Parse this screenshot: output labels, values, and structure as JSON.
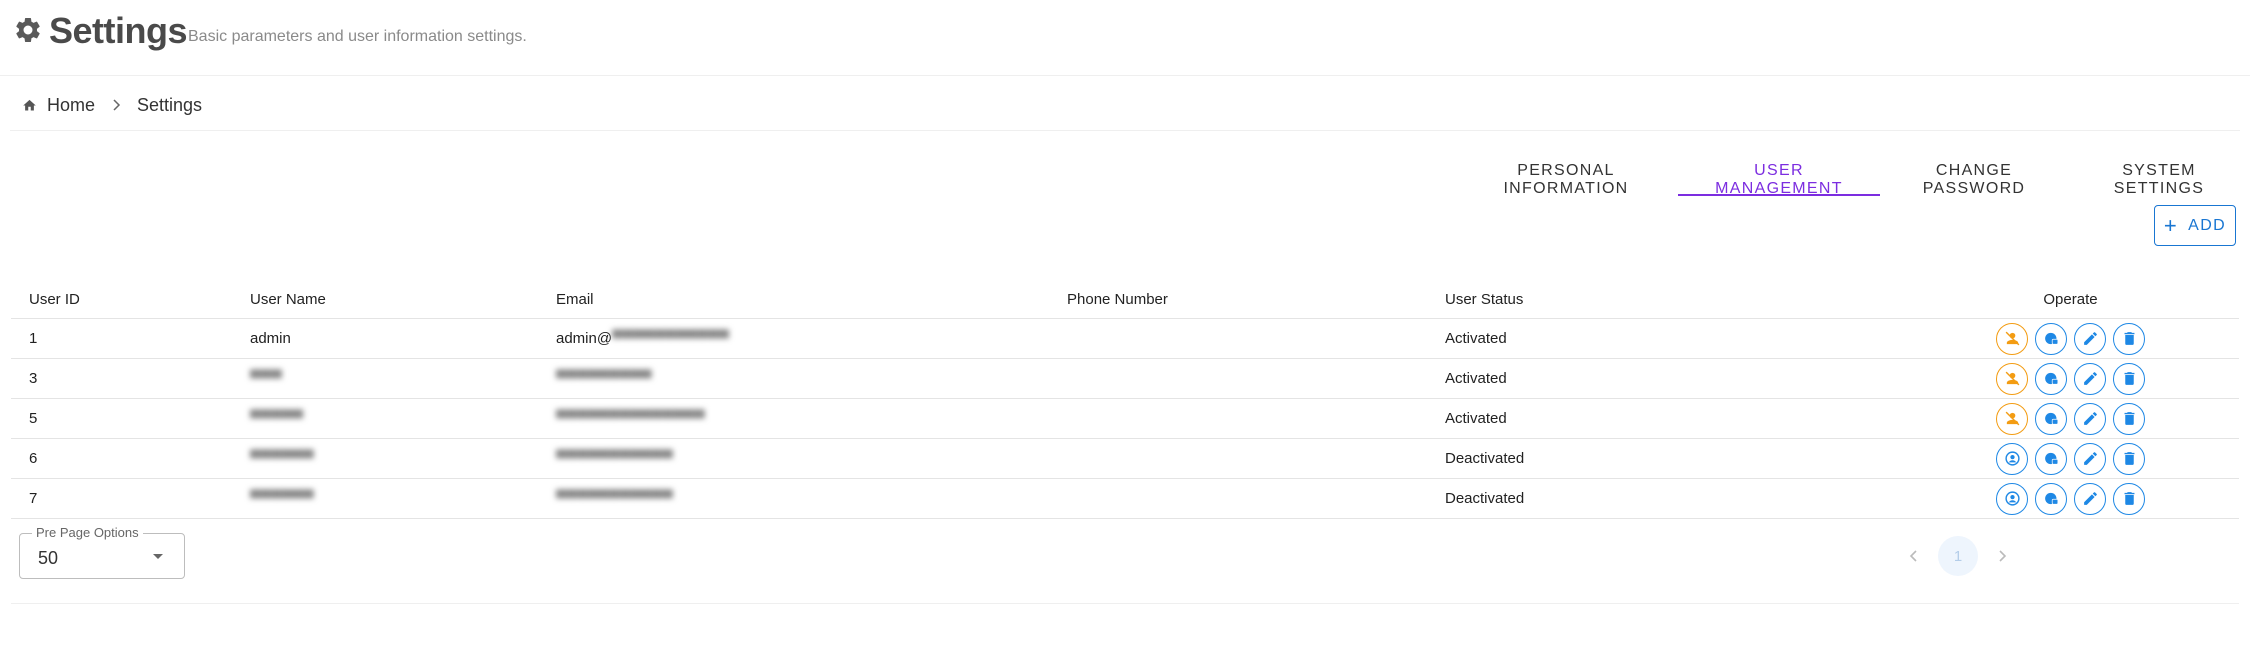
{
  "header": {
    "title": "Settings",
    "subtitle": "Basic parameters and user information settings.",
    "icon": "gear-icon"
  },
  "breadcrumb": {
    "home": "Home",
    "current": "Settings"
  },
  "tabs": [
    {
      "label": "PERSONAL INFORMATION",
      "active": false
    },
    {
      "label": "USER MANAGEMENT",
      "active": true
    },
    {
      "label": "CHANGE PASSWORD",
      "active": false
    },
    {
      "label": "SYSTEM SETTINGS",
      "active": false
    }
  ],
  "add_button": {
    "label": "ADD"
  },
  "table": {
    "columns": [
      "User ID",
      "User Name",
      "Email",
      "Phone Number",
      "User Status",
      "Operate"
    ],
    "rows": [
      {
        "id": "1",
        "name": "admin",
        "email": "admin@",
        "phone": "",
        "status": "Activated"
      },
      {
        "id": "3",
        "name": "",
        "email": "",
        "phone": "",
        "status": "Activated"
      },
      {
        "id": "5",
        "name": "",
        "email": "",
        "phone": "",
        "status": "Activated"
      },
      {
        "id": "6",
        "name": "",
        "email": "",
        "phone": "",
        "status": "Deactivated"
      },
      {
        "id": "7",
        "name": "",
        "email": "",
        "phone": "",
        "status": "Deactivated"
      }
    ]
  },
  "per_page": {
    "label": "Pre Page Options",
    "value": "50"
  },
  "pagination": {
    "current_page": "1"
  },
  "colors": {
    "accent_purple": "#7c2de0",
    "primary_blue": "#1976d2",
    "warning_orange": "#f39c12"
  }
}
